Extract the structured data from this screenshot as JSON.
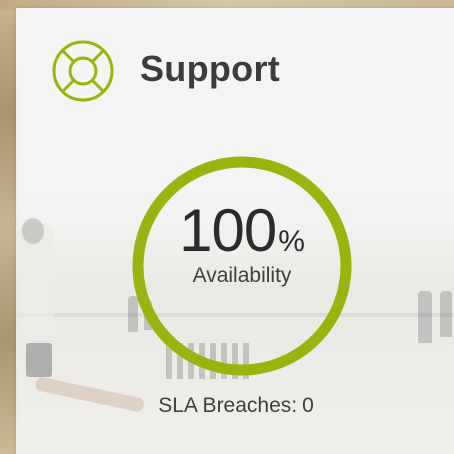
{
  "card": {
    "title": "Support",
    "icon": "lifebuoy-icon",
    "accent_color": "#9bb30e"
  },
  "gauge": {
    "value": "100",
    "unit": "%",
    "label": "Availability",
    "fill_fraction": 1.0
  },
  "sla": {
    "label": "SLA Breaches:",
    "value": "0"
  }
}
